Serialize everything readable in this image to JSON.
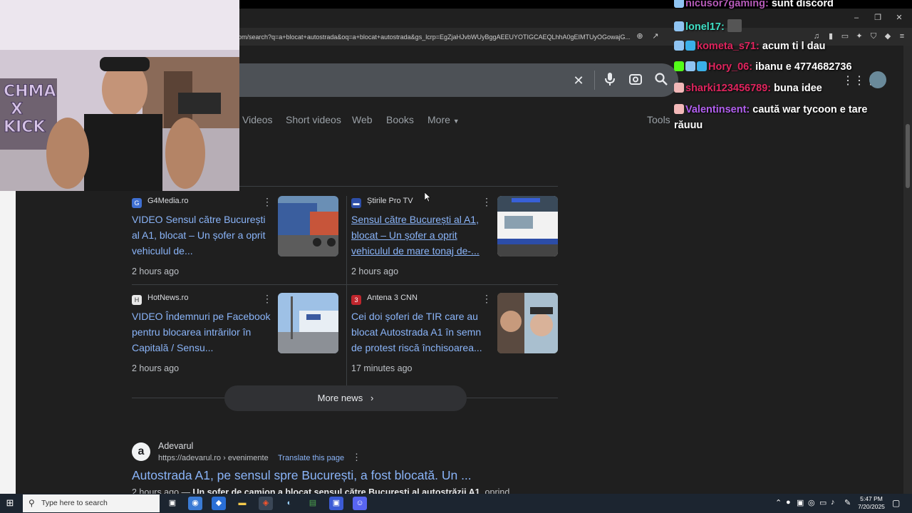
{
  "browser": {
    "url": "om/search?q=a+blocat+autostrada&oq=a+blocat+autostrada&gs_lcrp=EgZjaHJvbWUyBggAEEUYOTIGCAEQLhhA0gEIMTUyOGowajG...",
    "window_controls": {
      "minimize": "–",
      "restore": "❐",
      "close": "✕"
    }
  },
  "search": {
    "clear_icon": "✕",
    "mic_icon": "mic-icon",
    "lens_icon": "lens-icon",
    "search_icon": "search-icon"
  },
  "tabs": [
    {
      "label": "Videos"
    },
    {
      "label": "Short videos"
    },
    {
      "label": "Web"
    },
    {
      "label": "Books"
    },
    {
      "label": "More"
    },
    {
      "label": "Tools"
    }
  ],
  "news": [
    {
      "source": "G4Media.ro",
      "title": "VIDEO Sensul către București al A1, blocat – Un șofer a oprit vehiculul de...",
      "time": "2 hours ago",
      "icon_color": "#3f6fd1"
    },
    {
      "source": "Știrile Pro TV",
      "title": "Sensul către București al A1, blocat – Un șofer a oprit vehiculul de mare tonaj de-...",
      "time": "2 hours ago",
      "icon_color": "#2d4ea8"
    },
    {
      "source": "HotNews.ro",
      "title": "VIDEO Îndemnuri pe Facebook pentru blocarea intrărilor în Capitală / Sensu...",
      "time": "2 hours ago",
      "icon_color": "#e8e8e8"
    },
    {
      "source": "Antena 3 CNN",
      "title": "Cei doi șoferi de TIR care au blocat Autostrada A1 în semn de protest riscă închisoarea...",
      "time": "17 minutes ago",
      "icon_color": "#c0262d"
    }
  ],
  "more_news": {
    "label": "More news",
    "chevron": "›"
  },
  "result": {
    "favicon": "a",
    "site": "Adevarul",
    "url": "https://adevarul.ro › evenimente",
    "translate": "Translate this page",
    "menu": "⋮",
    "title": "Autostrada A1, pe sensul spre București, a fost blocată. Un ...",
    "snippet_time": "2 hours ago — ",
    "snippet_bold": "Un șofer de camion a blocat sensul către București al autostrăzii A1",
    "snippet_rest": ", oprind"
  },
  "chat": [
    {
      "user": "nicusor7gaming:",
      "msg": "sunt discord",
      "color": "#b55ab8"
    },
    {
      "user": "lonel17:",
      "msg": "",
      "color": "#3fe0c6"
    },
    {
      "user": "kometa_s71:",
      "msg": "acum ti l dau",
      "color": "#e0245e"
    },
    {
      "user": "Hory_06:",
      "msg": "ibanu e 4774682736",
      "color": "#e0245e"
    },
    {
      "user": "sharki123456789:",
      "msg": "buna idee",
      "color": "#e0245e"
    },
    {
      "user": "Valentinsent:",
      "msg": "caută war tycoon e tare",
      "color": "#b25ff0"
    },
    {
      "user": "",
      "msg": "răuuu",
      "color": "#ffffff"
    }
  ],
  "taskbar": {
    "search_placeholder": "Type here to search",
    "time": "5:47 PM",
    "date": "7/20/2025"
  }
}
